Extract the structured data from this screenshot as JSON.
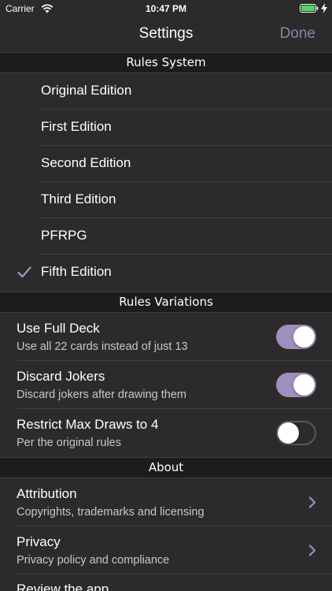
{
  "status": {
    "carrier": "Carrier",
    "time": "10:47 PM"
  },
  "nav": {
    "title": "Settings",
    "done_label": "Done"
  },
  "sections": {
    "rules_system": "Rules System",
    "rules_variations": "Rules Variations",
    "about": "About"
  },
  "editions": [
    {
      "label": "Original Edition",
      "checked": false
    },
    {
      "label": "First Edition",
      "checked": false
    },
    {
      "label": "Second Edition",
      "checked": false
    },
    {
      "label": "Third Edition",
      "checked": false
    },
    {
      "label": "PFRPG",
      "checked": false
    },
    {
      "label": "Fifth Edition",
      "checked": true
    }
  ],
  "variations": [
    {
      "title": "Use Full Deck",
      "subtitle": "Use all 22 cards instead of just 13",
      "on": true
    },
    {
      "title": "Discard Jokers",
      "subtitle": "Discard jokers after drawing them",
      "on": true
    },
    {
      "title": "Restrict Max Draws to 4",
      "subtitle": "Per the original rules",
      "on": false
    }
  ],
  "about": [
    {
      "title": "Attribution",
      "subtitle": "Copyrights, trademarks and licensing"
    },
    {
      "title": "Privacy",
      "subtitle": "Privacy policy and compliance"
    },
    {
      "title": "Review the app",
      "subtitle": ""
    }
  ],
  "colors": {
    "accent": "#9e8fbf",
    "done": "#8e82aa",
    "background": "#2b2b2b",
    "header": "#1c1c1c"
  },
  "icons": [
    "wifi-icon",
    "battery-icon",
    "charging-bolt-icon",
    "checkmark-icon",
    "chevron-right-icon"
  ]
}
